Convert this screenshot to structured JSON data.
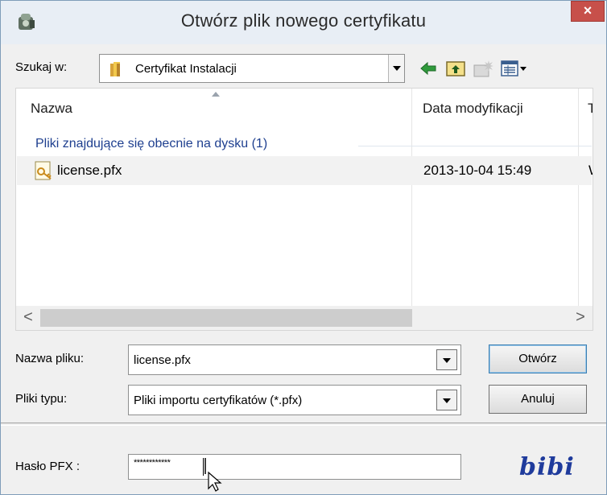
{
  "window": {
    "title": "Otwórz plik nowego certyfikatu",
    "close_label": "×"
  },
  "lookin": {
    "label": "Szukaj w:",
    "value": "Certyfikat Instalacji"
  },
  "filelist": {
    "columns": [
      "Nazwa",
      "Data modyfikacji",
      "Ty"
    ],
    "group_header": "Pliki znajdujące się obecnie na dysku (1)",
    "files": [
      {
        "name": "license.pfx",
        "date": "2013-10-04 15:49",
        "type": "W"
      }
    ],
    "scroll_left": "<",
    "scroll_right": ">"
  },
  "form": {
    "filename_label": "Nazwa pliku:",
    "filename_value": "license.pfx",
    "filetype_label": "Pliki typu:",
    "filetype_value": "Pliki importu certyfikatów (*.pfx)",
    "open_button": "Otwórz",
    "cancel_button": "Anuluj",
    "password_label": "Hasło PFX :",
    "password_value": "************"
  },
  "logo_text": "bibi",
  "colors": {
    "group_header": "#1e3f8f",
    "close_button": "#c7504a",
    "logo": "#1f3b9c"
  }
}
